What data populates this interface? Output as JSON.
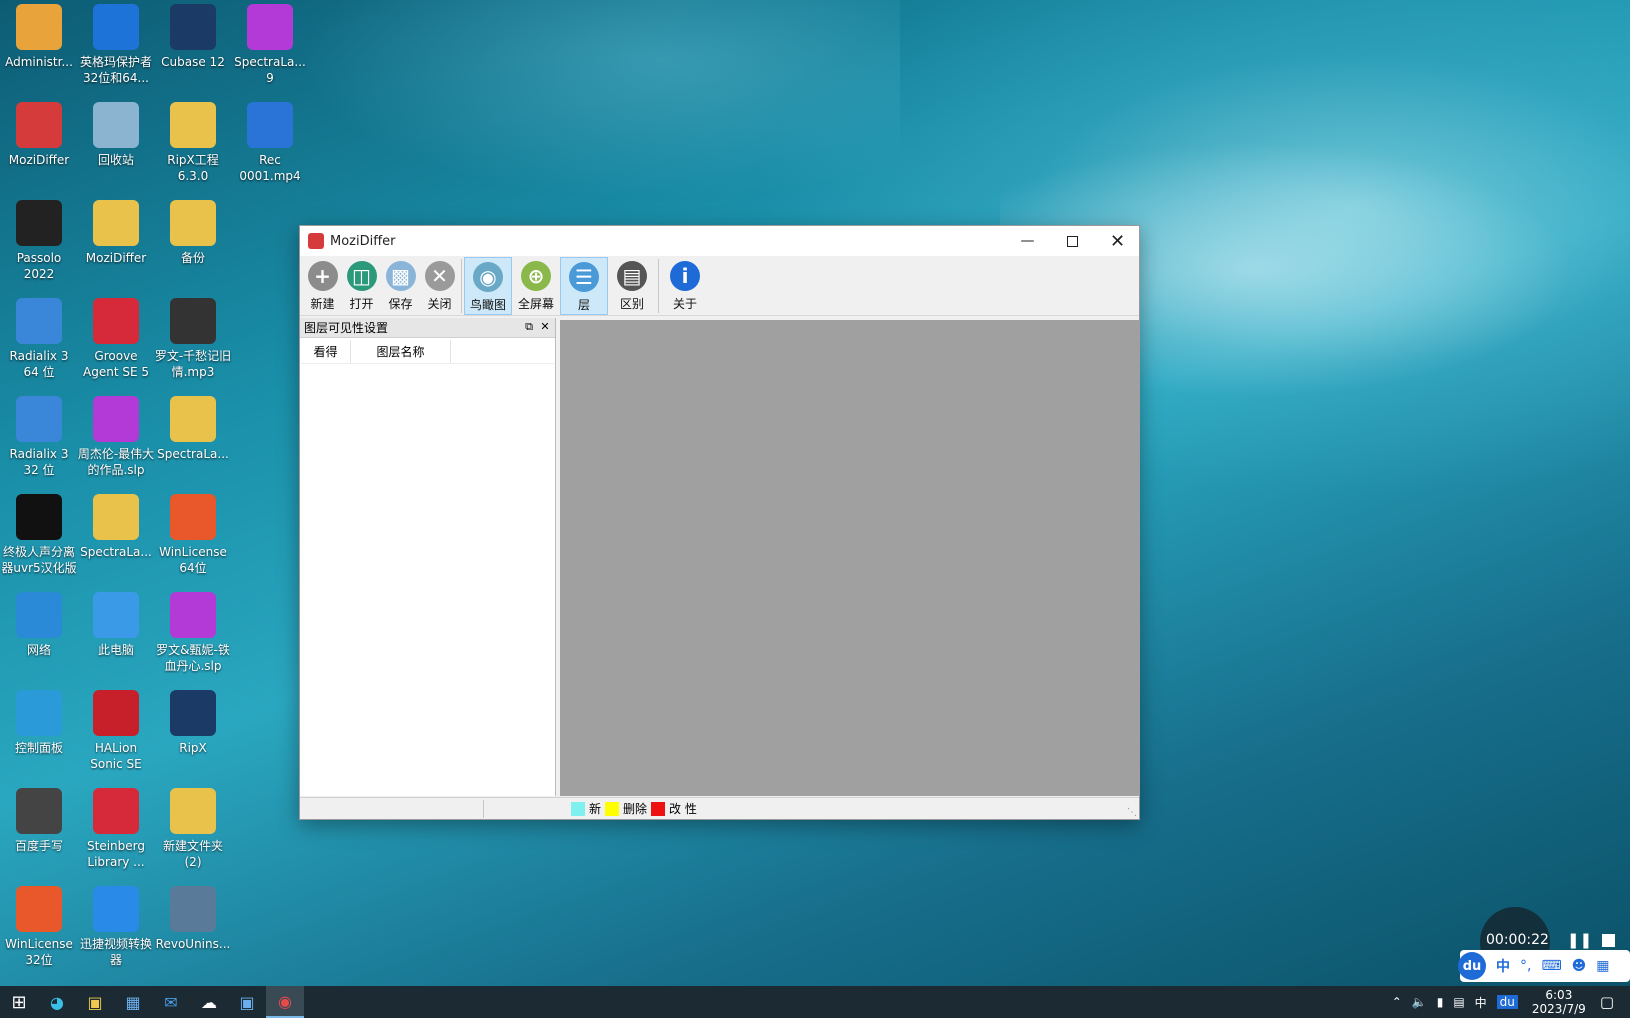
{
  "desktop": {
    "icons": [
      {
        "label": "Administr...",
        "color": "#e8a33a"
      },
      {
        "label": "英格玛保护者32位和64...",
        "color": "#1e73d8"
      },
      {
        "label": "Cubase 12",
        "color": "#1b3a66"
      },
      {
        "label": "SpectraLa... 9",
        "color": "#b43ad8"
      },
      {
        "label": "MoziDiffer",
        "color": "#d63b3b"
      },
      {
        "label": "回收站",
        "color": "#8ab4d0"
      },
      {
        "label": "RipX工程 6.3.0",
        "color": "#e8c24b"
      },
      {
        "label": "Rec 0001.mp4",
        "color": "#2a74d8"
      },
      {
        "label": "Passolo 2022",
        "color": "#222222"
      },
      {
        "label": "MoziDiffer",
        "color": "#e8c24b"
      },
      {
        "label": "备份",
        "color": "#e8c24b"
      },
      {
        "label": "Radialix 3 64 位",
        "color": "#3a86d8"
      },
      {
        "label": "Groove Agent SE 5",
        "color": "#d62a3a"
      },
      {
        "label": "罗文-千愁记旧情.mp3",
        "color": "#333333"
      },
      {
        "label": "Radialix 3 32 位",
        "color": "#3a86d8"
      },
      {
        "label": "周杰伦-最伟大的作品.slp",
        "color": "#b43ad8"
      },
      {
        "label": "SpectraLa...",
        "color": "#e8c24b"
      },
      {
        "label": "终极人声分离器uvr5汉化版",
        "color": "#111111"
      },
      {
        "label": "SpectraLa...",
        "color": "#e8c24b"
      },
      {
        "label": "WinLicense 64位",
        "color": "#e8582a"
      },
      {
        "label": "网络",
        "color": "#2a8ad8"
      },
      {
        "label": "此电脑",
        "color": "#3a9ae8"
      },
      {
        "label": "罗文&甄妮-铁血丹心.slp",
        "color": "#b43ad8"
      },
      {
        "label": "控制面板",
        "color": "#2a9ad8"
      },
      {
        "label": "HALion Sonic SE",
        "color": "#c8202a"
      },
      {
        "label": "RipX",
        "color": "#1b3a66"
      },
      {
        "label": "百度手写",
        "color": "#444444"
      },
      {
        "label": "Steinberg Library ...",
        "color": "#d62a3a"
      },
      {
        "label": "新建文件夹 (2)",
        "color": "#e8c24b"
      },
      {
        "label": "WinLicense 32位",
        "color": "#e8582a"
      },
      {
        "label": "迅捷视频转换器",
        "color": "#2a8ae8"
      },
      {
        "label": "RevoUnins...",
        "color": "#5a7a9a"
      }
    ]
  },
  "window": {
    "title": "MoziDiffer",
    "toolbar": [
      {
        "label": "新建",
        "icon": "plus-icon",
        "color": "#8c8c8c"
      },
      {
        "label": "打开",
        "icon": "folder-open-icon",
        "color": "#2a9a7a"
      },
      {
        "label": "保存",
        "icon": "save-icon",
        "color": "#8ab4d8"
      },
      {
        "label": "关闭",
        "icon": "close-circle-icon",
        "color": "#9a9a9a"
      },
      {
        "label": "鸟瞰图",
        "icon": "eye-icon",
        "color": "#6aa8c8"
      },
      {
        "label": "全屏幕",
        "icon": "zoom-icon",
        "color": "#8ab84a"
      },
      {
        "label": "层",
        "icon": "layers-icon",
        "color": "#4a9ad8"
      },
      {
        "label": "区别",
        "icon": "diff-icon",
        "color": "#555555"
      },
      {
        "label": "关于",
        "icon": "info-icon",
        "color": "#1e6bd8"
      }
    ],
    "layer_panel": {
      "title": "图层可见性设置",
      "col_visible": "看得",
      "col_name": "图层名称"
    },
    "status": {
      "new_label": "新",
      "delete_label": "删除",
      "change_label": "改 性",
      "new_color": "#7ff0f0",
      "delete_color": "#ffff00",
      "change_color": "#ee1111"
    }
  },
  "recorder": {
    "time": "00:00:22"
  },
  "ime": {
    "lang": "中"
  },
  "taskbar": {
    "tray_lang": "中",
    "time": "6:03",
    "date": "2023/7/9"
  }
}
